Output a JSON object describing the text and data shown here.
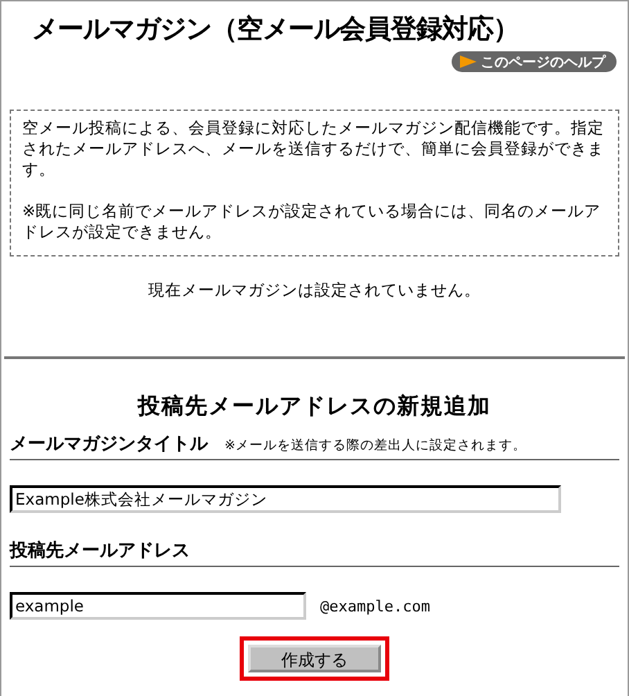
{
  "page_title": "メールマガジン（空メール会員登録対応）",
  "help_button": {
    "label": "このページのヘルプ"
  },
  "info_box": {
    "paragraphs": [
      "空メール投稿による、会員登録に対応したメールマガジン配信機能です。指定されたメールアドレスへ、メールを送信するだけで、簡単に会員登録ができます。",
      "※既に同じ名前でメールアドレスが設定されている場合には、同名のメールアドレスが設定できません。"
    ]
  },
  "status_message": "現在メールマガジンは設定されていません。",
  "form": {
    "heading": "投稿先メールアドレスの新規追加",
    "fields": [
      {
        "label": "メールマガジンタイトル",
        "note": "※メールを送信する際の差出人に設定されます。",
        "value": "Example株式会社メールマガジン",
        "kind": "wide"
      },
      {
        "label": "投稿先メールアドレス",
        "value": "example",
        "suffix": "@example.com",
        "kind": "short"
      }
    ],
    "submit": {
      "label": "作成する",
      "highlighted": true
    }
  }
}
